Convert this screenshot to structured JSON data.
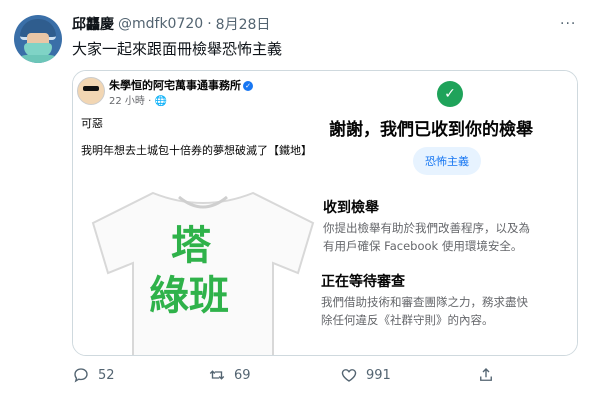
{
  "tweet": {
    "author_name": "邱龘慶",
    "handle": "@mdfk0720",
    "separator": "·",
    "date": "8月28日",
    "text": "大家一起來跟面冊檢舉恐怖主義",
    "more_label": "···"
  },
  "media": {
    "fb_post": {
      "page_name": "朱學恒的阿宅萬事通事務所",
      "time": "22 小時 · 🌐",
      "line1": "可惡",
      "line2": "我明年想去土城包十倍券的夢想破滅了【鐵地】",
      "shirt_text_1": "塔",
      "shirt_text_2": "綠班"
    },
    "report_panel": {
      "thanks": "謝謝，我們已收到你的檢舉",
      "chip": "恐怖主義",
      "section1_title": "收到檢舉",
      "section1_line1": "你提出檢舉有助於我們改善程序，以及為",
      "section1_line2": "有用戶確保 Facebook 使用環境安全。",
      "section2_title": "正在等待審查",
      "section2_line1": "我們借助技術和審查團隊之力，務求盡快",
      "section2_line2": "除任何違反《社群守則》的內容。"
    }
  },
  "actions": {
    "reply_count": "52",
    "retweet_count": "69",
    "like_count": "991"
  },
  "icons": [
    "reply-icon",
    "retweet-icon",
    "like-icon",
    "share-icon",
    "check-icon",
    "verified-icon"
  ],
  "colors": {
    "accent": "#1877f2",
    "shirt_green": "#2fb24a",
    "check_green": "#1fa35a"
  }
}
